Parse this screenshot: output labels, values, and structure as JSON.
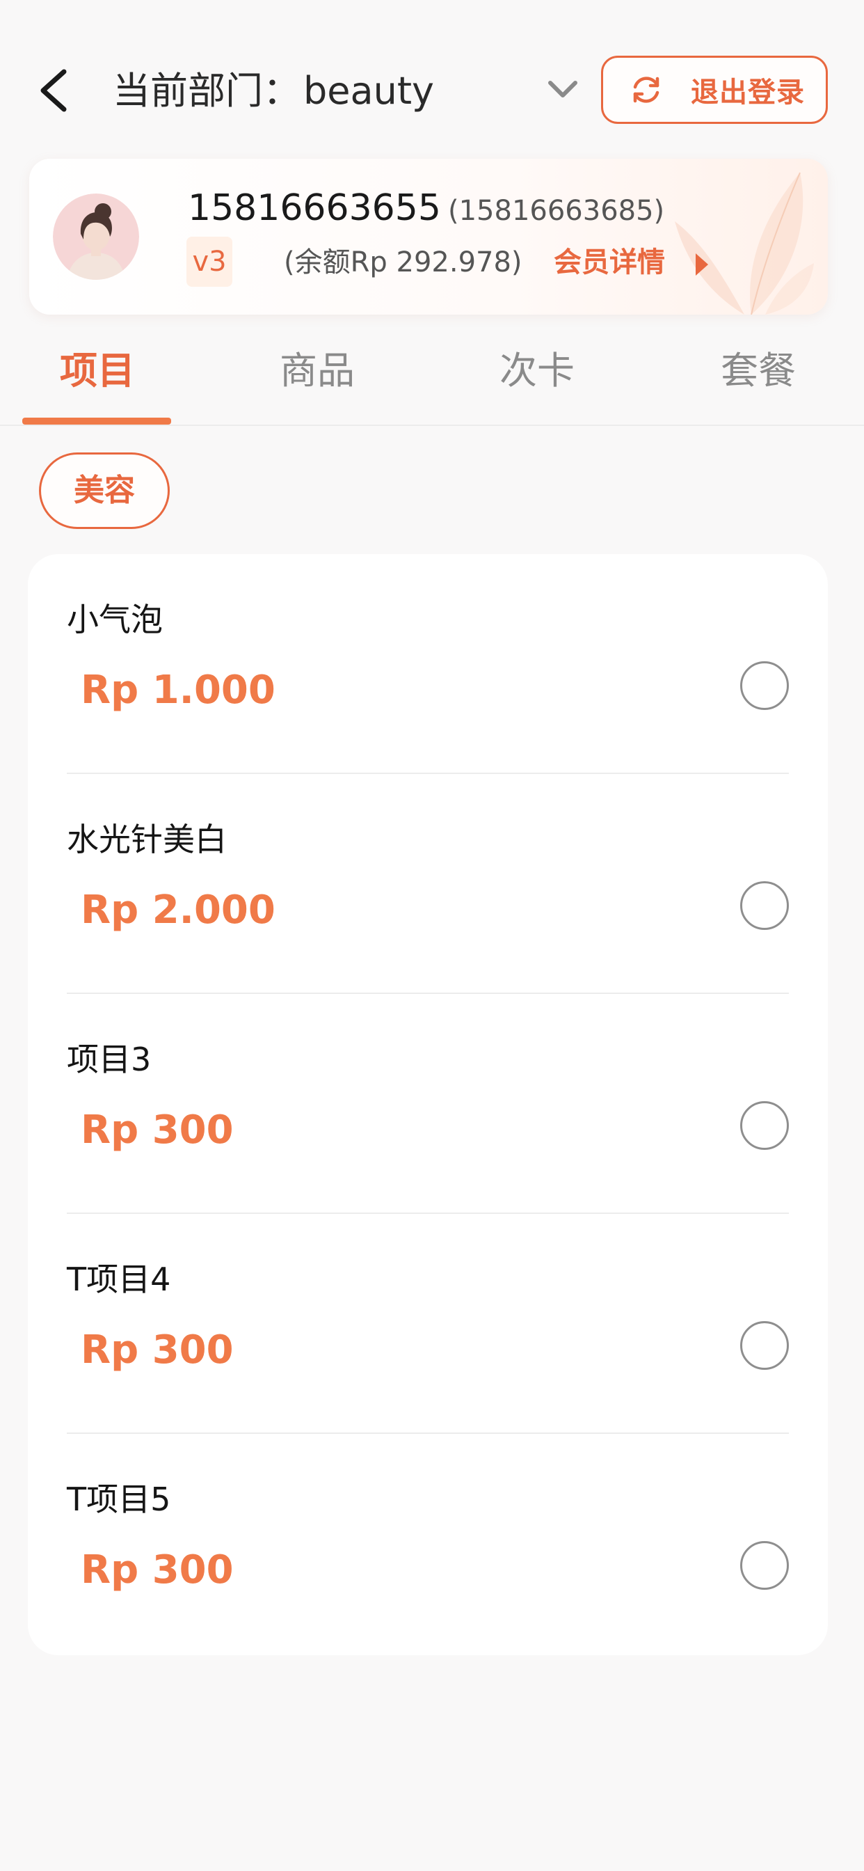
{
  "header": {
    "department_prefix": "当前部门：",
    "department_value": "beauty",
    "logout_label": "退出登录"
  },
  "member": {
    "phone": "15816663655",
    "phone_alt": "(15816663685)",
    "level": "v3",
    "balance": "(余额Rp 292.978)",
    "detail_label": "会员详情"
  },
  "tabs": [
    {
      "label": "项目",
      "active": true
    },
    {
      "label": "商品",
      "active": false
    },
    {
      "label": "次卡",
      "active": false
    },
    {
      "label": "套餐",
      "active": false
    }
  ],
  "category_chip": "美容",
  "items": [
    {
      "name": "小气泡",
      "price": "Rp 1.000",
      "selected": false
    },
    {
      "name": "水光针美白",
      "price": "Rp 2.000",
      "selected": false
    },
    {
      "name": "项目3",
      "price": "Rp 300",
      "selected": false
    },
    {
      "name": "T项目4",
      "price": "Rp 300",
      "selected": false
    },
    {
      "name": "T项目5",
      "price": "Rp 300",
      "selected": false
    }
  ],
  "colors": {
    "accent": "#e8683f",
    "price": "#f07a48",
    "background": "#f9f8f8"
  },
  "icons": [
    "back-arrow-icon",
    "chevron-down-icon",
    "refresh-icon",
    "play-arrow-icon",
    "radio-unchecked-icon"
  ]
}
